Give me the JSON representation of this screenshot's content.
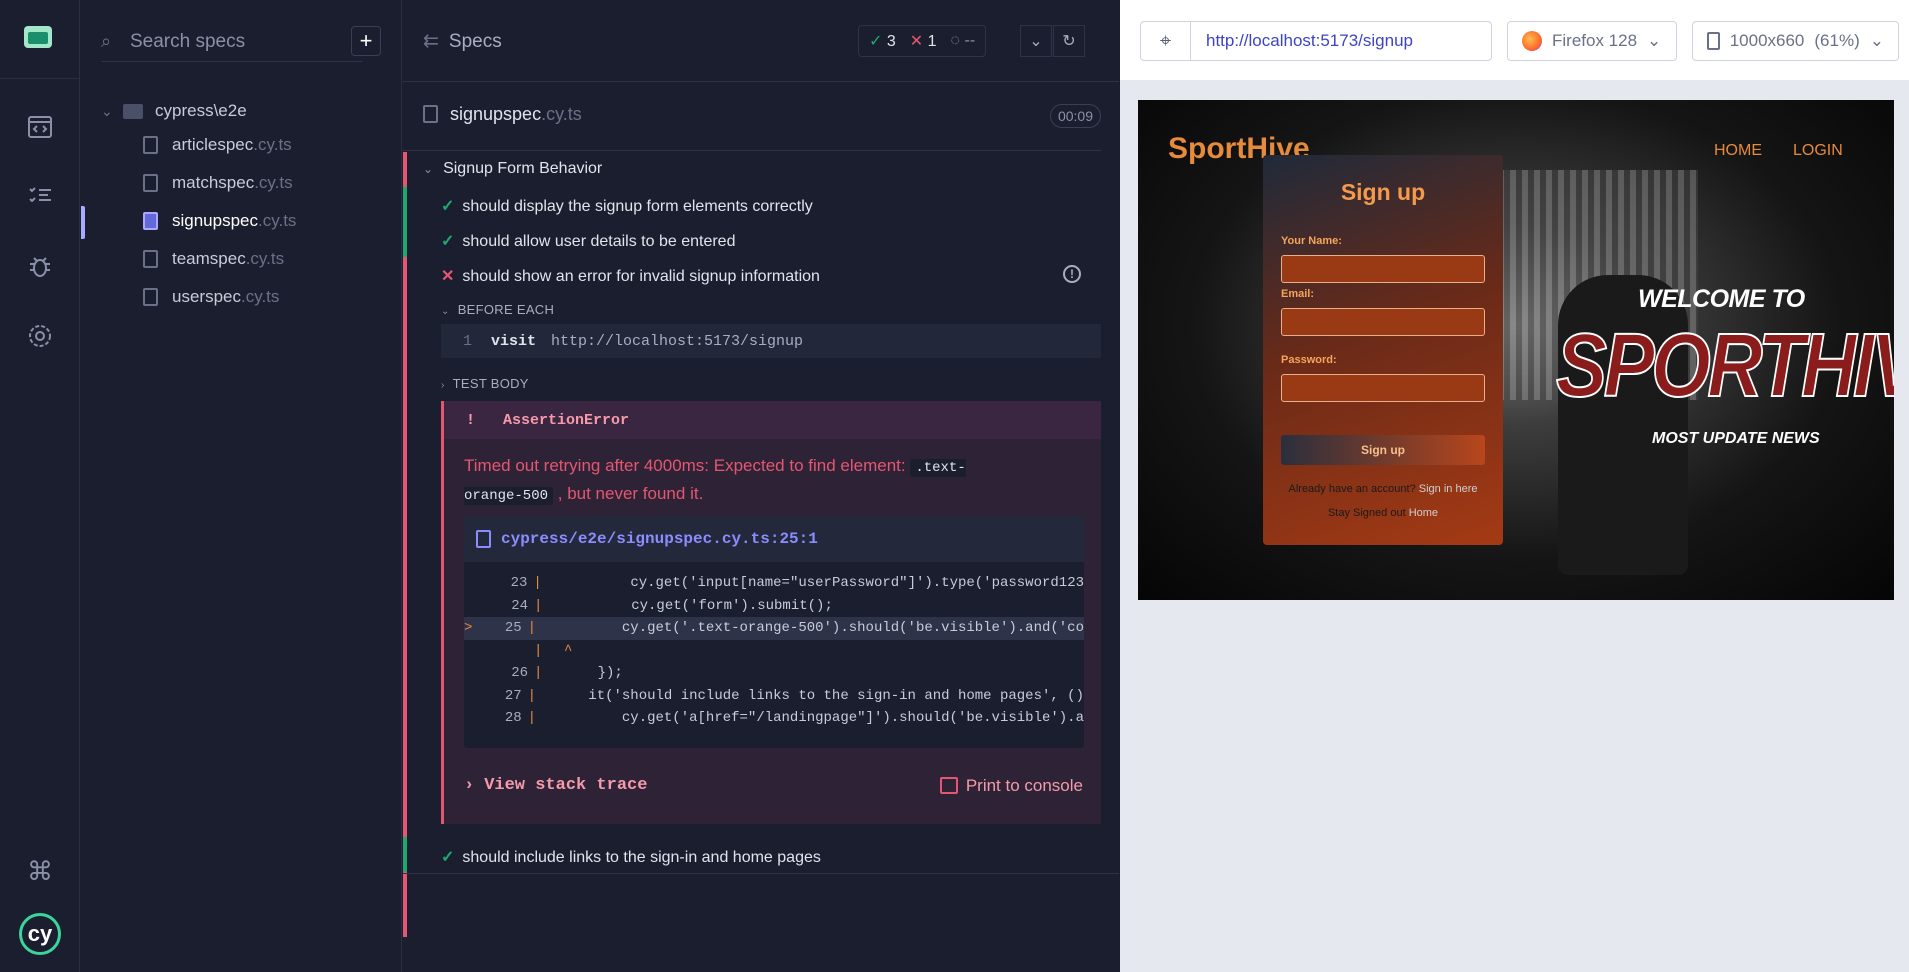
{
  "sidebar": {
    "search_placeholder": "Search specs",
    "add_label": "+",
    "folder": "cypress\\e2e",
    "files": [
      {
        "name": "articlespec",
        "ext": ".cy.ts"
      },
      {
        "name": "matchspec",
        "ext": ".cy.ts"
      },
      {
        "name": "signupspec",
        "ext": ".cy.ts"
      },
      {
        "name": "teamspec",
        "ext": ".cy.ts"
      },
      {
        "name": "userspec",
        "ext": ".cy.ts"
      }
    ]
  },
  "reporter": {
    "title": "Specs",
    "passed": "3",
    "failed": "1",
    "pending": "--",
    "spec_name": "signupspec",
    "spec_ext": ".cy.ts",
    "duration": "00:09",
    "suite": "Signup Form Behavior",
    "tests": [
      "should display the signup form elements correctly",
      "should allow user details to be entered",
      "should show an error for invalid signup information",
      "should include links to the sign-in and home pages"
    ],
    "before_each": "BEFORE EACH",
    "command_num": "1",
    "command_name": "visit",
    "command_value": "http://localhost:5173/signup",
    "test_body": "TEST BODY",
    "error": {
      "type": "AssertionError",
      "marker": "!",
      "msg_pre": "Timed out retrying after 4000ms: Expected to find element:",
      "msg_code": ".text-orange-500",
      "msg_post": ", but never found it.",
      "file": "cypress/e2e/signupspec.cy.ts:25:1",
      "lines": [
        {
          "n": "23",
          "code": "        cy.get('input[name=\"userPassword\"]').type('password123"
        },
        {
          "n": "24",
          "code": "        cy.get('form').submit();"
        },
        {
          "n": "25",
          "code": "        cy.get('.text-orange-500').should('be.visible').and('co"
        },
        {
          "n": "",
          "code": "^"
        },
        {
          "n": "26",
          "code": "    });"
        },
        {
          "n": "27",
          "code": "    it('should include links to the sign-in and home pages', ()"
        },
        {
          "n": "28",
          "code": "        cy.get('a[href=\"/landingpage\"]').should('be.visible').a"
        }
      ],
      "view_stack": "View stack trace",
      "print": "Print to console"
    }
  },
  "browser": {
    "url": "http://localhost:5173/signup",
    "browser_name": "Firefox 128",
    "viewport": "1000x660",
    "scale": "(61%)"
  },
  "preview": {
    "brand": "SportHive",
    "nav_home": "HOME",
    "nav_login": "LOGIN",
    "form_title": "Sign up",
    "label_name": "Your Name:",
    "label_email": "Email:",
    "label_password": "Password:",
    "signup_btn": "Sign up",
    "already": "Already have an account?",
    "signin_link": "Sign in here",
    "stay": "Stay Signed out",
    "home_link": "Home",
    "welcome": "WELCOME TO",
    "hero": "SPORTHIVE",
    "tagline": "MOST UPDATE NEWS"
  }
}
